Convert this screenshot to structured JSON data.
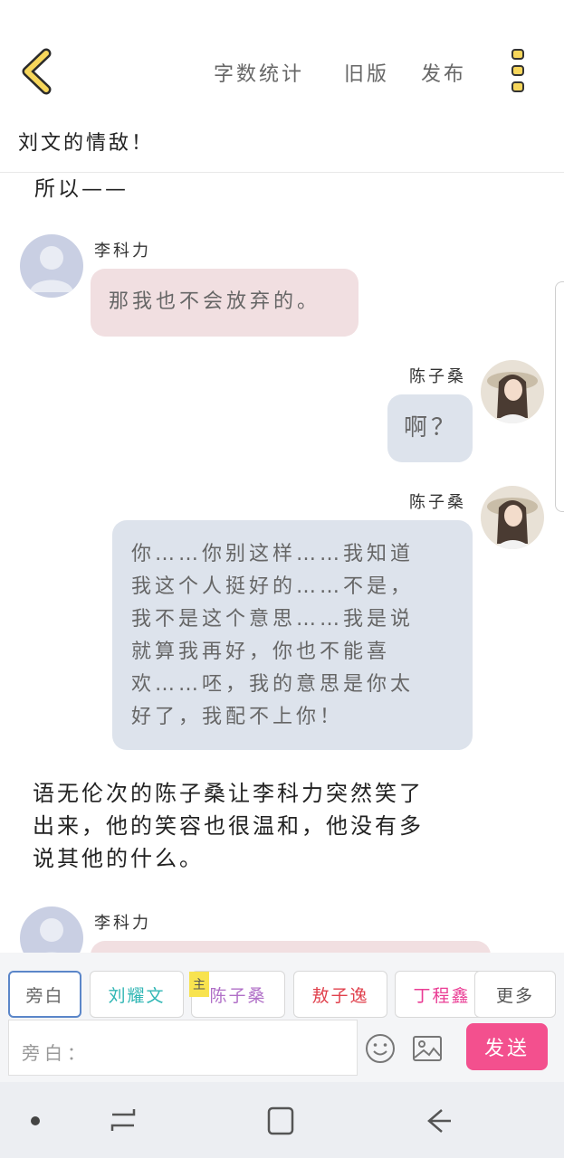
{
  "header": {
    "actions": {
      "word_count": "字数统计",
      "old_version": "旧版",
      "publish": "发布"
    },
    "back_icon": "chevron-left-icon",
    "more_icon": "vertical-dots-icon",
    "accent_color": "#f6d65b"
  },
  "title": "刘文的情敌！",
  "chat": {
    "narration_top": "所以——",
    "messages": [
      {
        "speaker": "李科力",
        "text": "那我也不会放弃的。",
        "side": "left",
        "bubble_color": "#f1dfe1"
      },
      {
        "speaker": "陈子桑",
        "text": "啊？",
        "side": "right",
        "bubble_color": "#dde3ec"
      },
      {
        "speaker": "陈子桑",
        "lines": [
          "你……你别这样……我知道",
          "我这个人挺好的……不是，",
          "我不是这个意思……我是说",
          "就算我再好，你也不能喜",
          "欢……呸，我的意思是你太",
          "好了，我配不上你！"
        ],
        "side": "right",
        "bubble_color": "#dde3ec"
      }
    ],
    "narration_mid": [
      "语无伦次的陈子桑让李科力突然笑了",
      "出来，他的笑容也很温和，他没有多",
      "说其他的什么。"
    ],
    "last_speaker": "李科力"
  },
  "picker": {
    "chips": [
      {
        "label": "旁白",
        "color": "#666666",
        "selected": true
      },
      {
        "label": "刘耀文",
        "color": "#30b6b4"
      },
      {
        "label": "陈子桑",
        "color": "#b06fc7",
        "badge": "主"
      },
      {
        "label": "敖子逸",
        "color": "#e0404c"
      },
      {
        "label": "丁程鑫",
        "color": "#ea3c94"
      }
    ],
    "more_label": "更多",
    "input_placeholder": "旁白：",
    "emoji_icon": "smiley-icon",
    "image_icon": "image-icon",
    "send_label": "发送",
    "send_color": "#f3508e"
  },
  "navbar": {
    "icons": [
      "dot-icon",
      "recents-icon",
      "home-icon",
      "back-icon"
    ]
  }
}
